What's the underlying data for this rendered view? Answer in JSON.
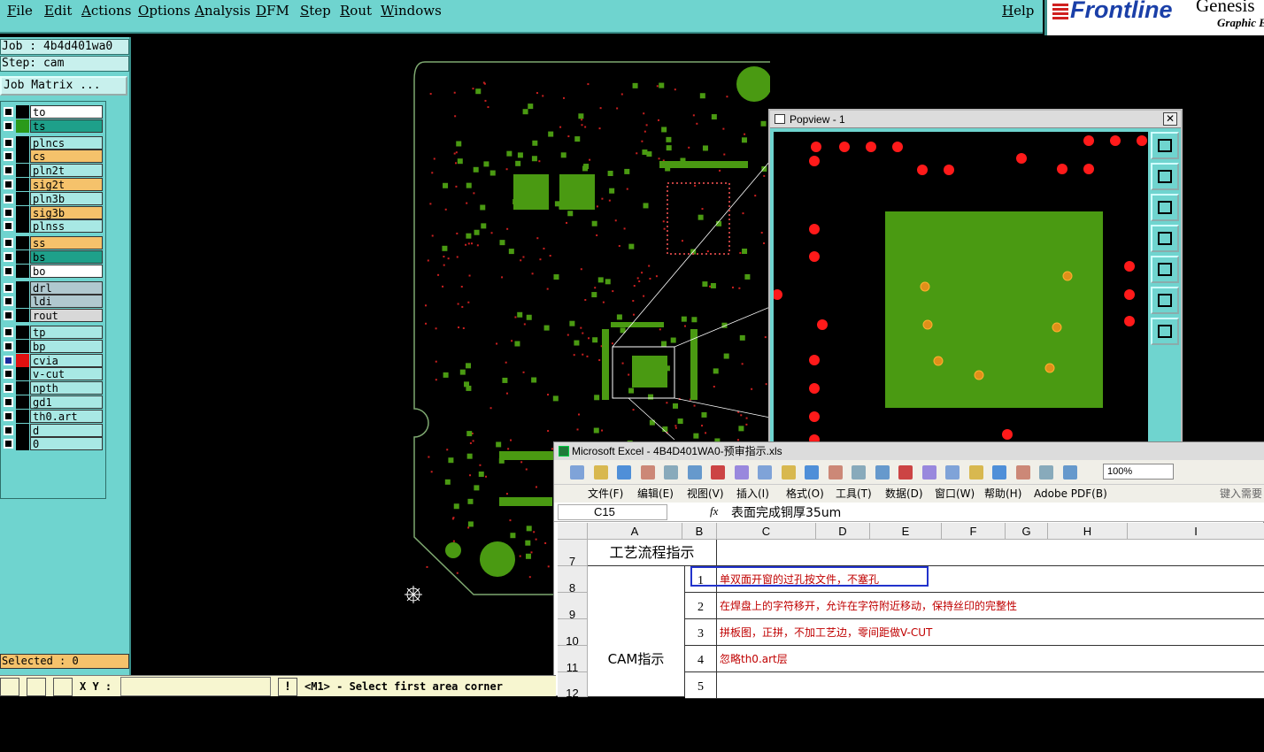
{
  "menu": [
    "File",
    "Edit",
    "Actions",
    "Options",
    "Analysis",
    "DFM",
    "Step",
    "Rout",
    "Windows"
  ],
  "help": "Help",
  "logo": {
    "brand": "Frontline",
    "sub1": "Genesis",
    "sub2": "Graphic E"
  },
  "job": "Job : 4b4d401wa0",
  "step": "Step: cam",
  "job_matrix": "Job Matrix ...",
  "layers": [
    {
      "name": "to",
      "color": "#ffffff"
    },
    {
      "name": "ts",
      "color": "#1ea08a"
    },
    {
      "name": "plncs",
      "color": "#a8e8e4"
    },
    {
      "name": "cs",
      "color": "#f5c26b"
    },
    {
      "name": "pln2t",
      "color": "#a8e8e4"
    },
    {
      "name": "sig2t",
      "color": "#f5c26b"
    },
    {
      "name": "pln3b",
      "color": "#a8e8e4"
    },
    {
      "name": "sig3b",
      "color": "#f5c26b"
    },
    {
      "name": "plnss",
      "color": "#a8e8e4"
    },
    {
      "name": "ss",
      "color": "#f5c26b"
    },
    {
      "name": "bs",
      "color": "#1ea08a"
    },
    {
      "name": "bo",
      "color": "#ffffff"
    },
    {
      "name": "drl",
      "color": "#b0c8cf"
    },
    {
      "name": "ldi",
      "color": "#b0c8cf"
    },
    {
      "name": "rout",
      "color": "#d8d8d8"
    },
    {
      "name": "tp",
      "color": "#a8e8e4"
    },
    {
      "name": "bp",
      "color": "#a8e8e4"
    },
    {
      "name": "cvia",
      "color": "#a8e8e4"
    },
    {
      "name": "v-cut",
      "color": "#a8e8e4"
    },
    {
      "name": "npth",
      "color": "#a8e8e4"
    },
    {
      "name": "gd1",
      "color": "#a8e8e4"
    },
    {
      "name": "th0.art",
      "color": "#a8e8e4"
    },
    {
      "name": "d",
      "color": "#a8e8e4"
    },
    {
      "name": "0",
      "color": "#a8e8e4"
    }
  ],
  "selected": "Selected : 0",
  "xy_label": "X Y :",
  "status": "<M1> - Select first area corner",
  "popview": {
    "title": "Popview - 1",
    "close": "✕"
  },
  "excel": {
    "title": "Microsoft Excel - 4B4D401WA0-预审指示.xls",
    "menus": [
      "文件(F)",
      "编辑(E)",
      "视图(V)",
      "插入(I)",
      "格式(O)",
      "工具(T)",
      "数据(D)",
      "窗口(W)",
      "帮助(H)",
      "Adobe PDF(B)"
    ],
    "help_prompt": "键入需要帮",
    "zoom": "100%",
    "cell_ref": "C15",
    "fx": "fx",
    "formula": "表面完成铜厚35um",
    "columns": [
      "A",
      "B",
      "C",
      "D",
      "E",
      "F",
      "G",
      "H",
      "I"
    ],
    "rows": [
      "7",
      "8",
      "9",
      "10",
      "11",
      "12"
    ],
    "section1": "工艺流程指示",
    "section2": "CAM指示",
    "items": [
      {
        "num": "1",
        "text": "单双面开窗的过孔按文件，不塞孔"
      },
      {
        "num": "2",
        "text": "在焊盘上的字符移开，允许在字符附近移动，保持丝印的完整性"
      },
      {
        "num": "3",
        "text": "拼板图，正拼，不加工艺边，零间距做V-CUT"
      },
      {
        "num": "4",
        "text": "忽略th0.art层"
      },
      {
        "num": "5",
        "text": ""
      }
    ]
  }
}
